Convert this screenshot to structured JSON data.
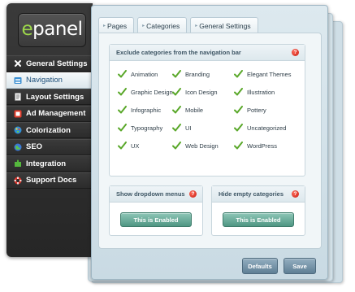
{
  "logo": {
    "text_accent": "e",
    "text_rest": "panel"
  },
  "sidebar": {
    "items": [
      {
        "label": "General Settings",
        "icon": "x-icon"
      },
      {
        "label": "Navigation",
        "icon": "list-icon"
      },
      {
        "label": "Layout Settings",
        "icon": "document-icon"
      },
      {
        "label": "Ad Management",
        "icon": "ad-icon"
      },
      {
        "label": "Colorization",
        "icon": "palette-icon"
      },
      {
        "label": "SEO",
        "icon": "globe-icon"
      },
      {
        "label": "Integration",
        "icon": "puzzle-icon"
      },
      {
        "label": "Support Docs",
        "icon": "lifebuoy-icon"
      }
    ],
    "active_index": 1
  },
  "tabs": [
    {
      "label": "Pages"
    },
    {
      "label": "Categories"
    },
    {
      "label": "General Settings"
    }
  ],
  "categories_box": {
    "title": "Exclude categories from the navigation bar",
    "help": "?",
    "items": [
      "Animation",
      "Branding",
      "Elegant Themes",
      "Graphic Design",
      "Icon Design",
      "Illustration",
      "Infographic",
      "Mobile",
      "Pottery",
      "Typography",
      "UI",
      "Uncategorized",
      "UX",
      "Web Design",
      "WordPress"
    ]
  },
  "options": [
    {
      "title": "Show dropdown menus",
      "help": "?",
      "button": "This is Enabled"
    },
    {
      "title": "Hide empty categories",
      "help": "?",
      "button": "This is Enabled"
    }
  ],
  "actions": {
    "defaults": "Defaults",
    "save": "Save"
  },
  "colors": {
    "accent_green": "#4f9683",
    "check_green": "#5aa82a",
    "nav_blue": "#1d4f7a",
    "help_red": "#c81e12"
  }
}
